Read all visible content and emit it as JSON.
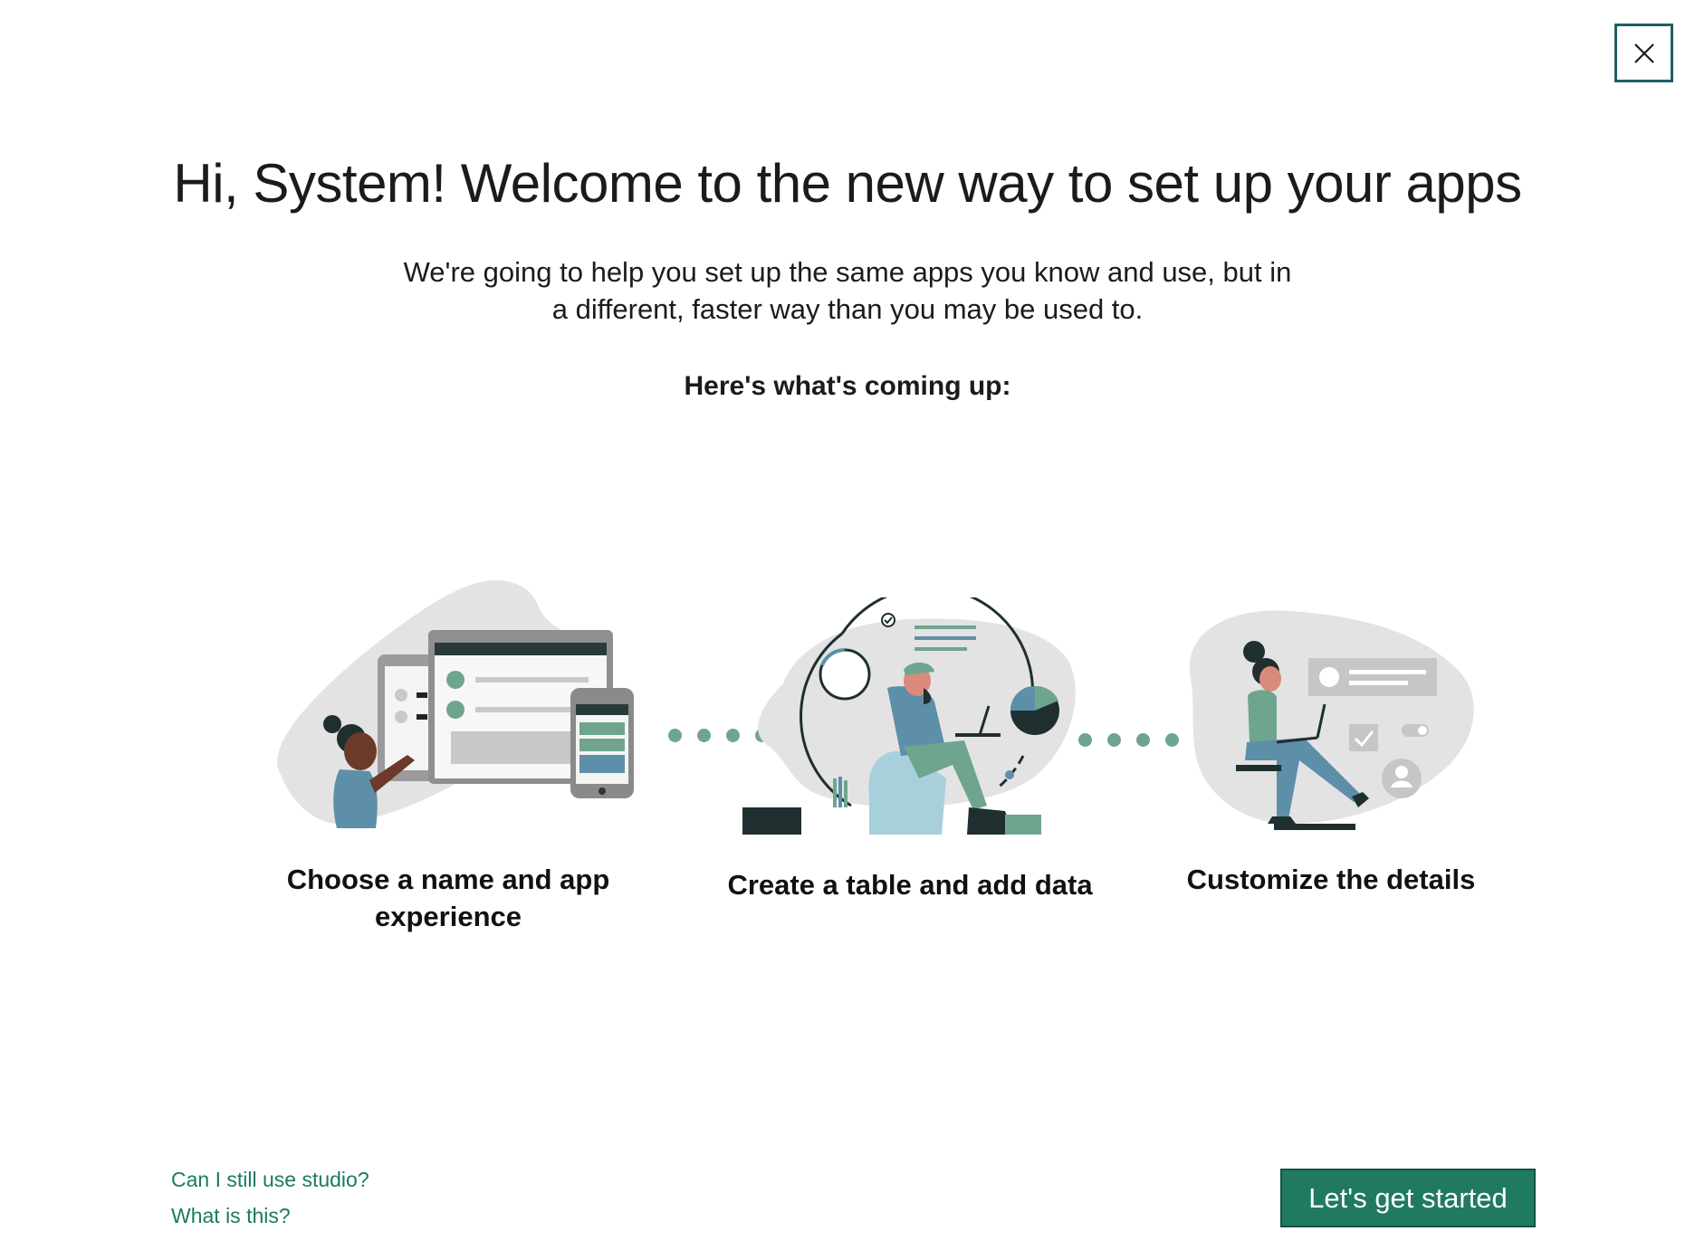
{
  "dialog": {
    "title": "Hi, System! Welcome to the new way to set up your apps",
    "subtitle_line1": "We're going to help you set up the same apps you know and use, but in",
    "subtitle_line2": "a different, faster way than you may be used to.",
    "coming_up": "Here's what's coming up:"
  },
  "steps": [
    {
      "label_line1": "Choose a name and app",
      "label_line2": "experience",
      "icon": "devices-illustration"
    },
    {
      "label_line1": "Create a table and add data",
      "label_line2": "",
      "icon": "data-illustration"
    },
    {
      "label_line1": "Customize the details",
      "label_line2": "",
      "icon": "customize-illustration"
    }
  ],
  "links": {
    "studio": "Can I still use studio?",
    "what": "What is this?"
  },
  "primary_button": "Let's get started",
  "colors": {
    "accent": "#1f7a60",
    "link": "#1a7a64",
    "dots": "#6fa58f",
    "close_border": "#1e5f66"
  }
}
